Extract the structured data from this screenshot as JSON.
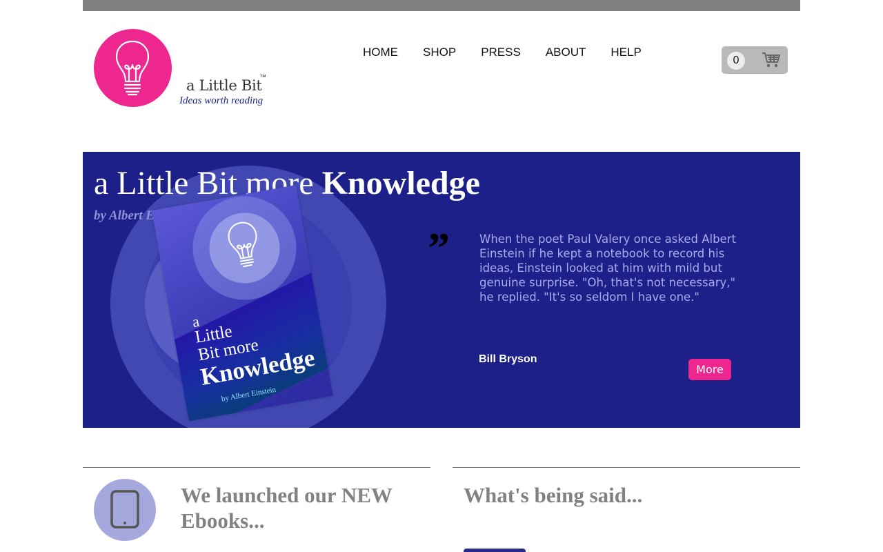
{
  "brand": {
    "name": "a Little Bit",
    "trademark": "™",
    "tagline": "Ideas worth reading",
    "logo_icon": "lightbulb-icon",
    "logo_color": "#ee2690"
  },
  "nav": {
    "items": [
      {
        "label": "HOME"
      },
      {
        "label": "SHOP"
      },
      {
        "label": "PRESS"
      },
      {
        "label": "ABOUT"
      },
      {
        "label": "HELP"
      }
    ]
  },
  "cart": {
    "count": "0",
    "icon": "shopping-cart-icon"
  },
  "hero": {
    "title_regular": "a Little Bit more ",
    "title_bold": "Knowledge",
    "author": "by Albert Einstein",
    "background_color": "#1c2088",
    "quote_mark": "”",
    "quote": "When the poet Paul Valery once asked Albert Einstein if he kept a notebook to record his ideas, Einstein looked at him with mild but genuine surprise. \"Oh, that's not necessary,\" he replied. \"It's so seldom I have one.\"",
    "quote_author": "Bill Bryson",
    "more_label": "More",
    "book": {
      "line1": "a",
      "line2": "Little",
      "line3": "Bit more",
      "line4": "Knowledge",
      "author": "by Albert Einstein"
    }
  },
  "sections": {
    "ebooks": {
      "title": "We launched our NEW Ebooks...",
      "icon": "tablet-icon"
    },
    "testimonials": {
      "title": "What's being said..."
    }
  }
}
